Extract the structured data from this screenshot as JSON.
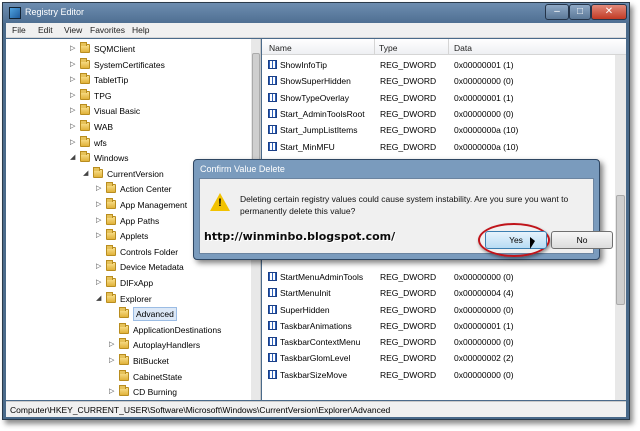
{
  "window": {
    "title": "Registry Editor",
    "min": "–",
    "max": "□",
    "close": "✕"
  },
  "menu": [
    "File",
    "Edit",
    "View",
    "Favorites",
    "Help"
  ],
  "tree": [
    {
      "label": "SQMClient",
      "indent": 1,
      "arrow": "▷"
    },
    {
      "label": "SystemCertificates",
      "indent": 1,
      "arrow": "▷"
    },
    {
      "label": "TabletTip",
      "indent": 1,
      "arrow": "▷"
    },
    {
      "label": "TPG",
      "indent": 1,
      "arrow": "▷"
    },
    {
      "label": "Visual Basic",
      "indent": 1,
      "arrow": "▷"
    },
    {
      "label": "WAB",
      "indent": 1,
      "arrow": "▷"
    },
    {
      "label": "wfs",
      "indent": 1,
      "arrow": "▷"
    },
    {
      "label": "Windows",
      "indent": 1,
      "arrow": "◢"
    },
    {
      "label": "CurrentVersion",
      "indent": 2,
      "arrow": "◢"
    },
    {
      "label": "Action Center",
      "indent": 3,
      "arrow": "▷"
    },
    {
      "label": "App Management",
      "indent": 3,
      "arrow": "▷"
    },
    {
      "label": "App Paths",
      "indent": 3,
      "arrow": "▷"
    },
    {
      "label": "Applets",
      "indent": 3,
      "arrow": "▷"
    },
    {
      "label": "Controls Folder",
      "indent": 3,
      "arrow": ""
    },
    {
      "label": "Device Metadata",
      "indent": 3,
      "arrow": "▷"
    },
    {
      "label": "DIFxApp",
      "indent": 3,
      "arrow": "▷"
    },
    {
      "label": "Explorer",
      "indent": 3,
      "arrow": "◢"
    },
    {
      "label": "Advanced",
      "indent": 4,
      "arrow": "",
      "selected": true
    },
    {
      "label": "ApplicationDestinations",
      "indent": 4,
      "arrow": ""
    },
    {
      "label": "AutoplayHandlers",
      "indent": 4,
      "arrow": "▷"
    },
    {
      "label": "BitBucket",
      "indent": 4,
      "arrow": "▷"
    },
    {
      "label": "CabinetState",
      "indent": 4,
      "arrow": ""
    },
    {
      "label": "CD Burning",
      "indent": 4,
      "arrow": "▷"
    }
  ],
  "columns": {
    "name": "Name",
    "type": "Type",
    "data": "Data"
  },
  "rows": [
    {
      "name": "ShowInfoTip",
      "type": "REG_DWORD",
      "data": "0x00000001 (1)"
    },
    {
      "name": "ShowSuperHidden",
      "type": "REG_DWORD",
      "data": "0x00000000 (0)"
    },
    {
      "name": "ShowTypeOverlay",
      "type": "REG_DWORD",
      "data": "0x00000001 (1)"
    },
    {
      "name": "Start_AdminToolsRoot",
      "type": "REG_DWORD",
      "data": "0x00000000 (0)"
    },
    {
      "name": "Start_JumpListItems",
      "type": "REG_DWORD",
      "data": "0x0000000a (10)"
    },
    {
      "name": "Start_MinMFU",
      "type": "REG_DWORD",
      "data": "0x0000000a (10)"
    },
    {
      "name": "",
      "type": "",
      "data": ""
    },
    {
      "name": "",
      "type": "",
      "data": ""
    },
    {
      "name": "",
      "type": "",
      "data": ""
    },
    {
      "name": "",
      "type": "",
      "data": ""
    },
    {
      "name": "",
      "type": "",
      "data": ""
    },
    {
      "name": "",
      "type": "",
      "data": ""
    },
    {
      "name": "",
      "type": "",
      "data": ""
    },
    {
      "name": "StartMenuAdminTools",
      "type": "REG_DWORD",
      "data": "0x00000000 (0)"
    },
    {
      "name": "StartMenuInit",
      "type": "REG_DWORD",
      "data": "0x00000004 (4)"
    },
    {
      "name": "SuperHidden",
      "type": "REG_DWORD",
      "data": "0x00000000 (0)"
    },
    {
      "name": "TaskbarAnimations",
      "type": "REG_DWORD",
      "data": "0x00000001 (1)"
    },
    {
      "name": "TaskbarContextMenu",
      "type": "REG_DWORD",
      "data": "0x00000000 (0)"
    },
    {
      "name": "TaskbarGlomLevel",
      "type": "REG_DWORD",
      "data": "0x00000002 (2)"
    },
    {
      "name": "TaskbarSizeMove",
      "type": "REG_DWORD",
      "data": "0x00000000 (0)"
    },
    {
      "name": "",
      "type": "",
      "data": ""
    }
  ],
  "status": "Computer\\HKEY_CURRENT_USER\\Software\\Microsoft\\Windows\\CurrentVersion\\Explorer\\Advanced",
  "dialog": {
    "title": "Confirm Value Delete",
    "message": "Deleting certain registry values could cause system instability. Are you sure you want to permanently delete this value?",
    "yes": "Yes",
    "no": "No",
    "warning_icon": "warning-triangle-icon"
  },
  "watermark": "http://winminbo.blogspot.com/"
}
